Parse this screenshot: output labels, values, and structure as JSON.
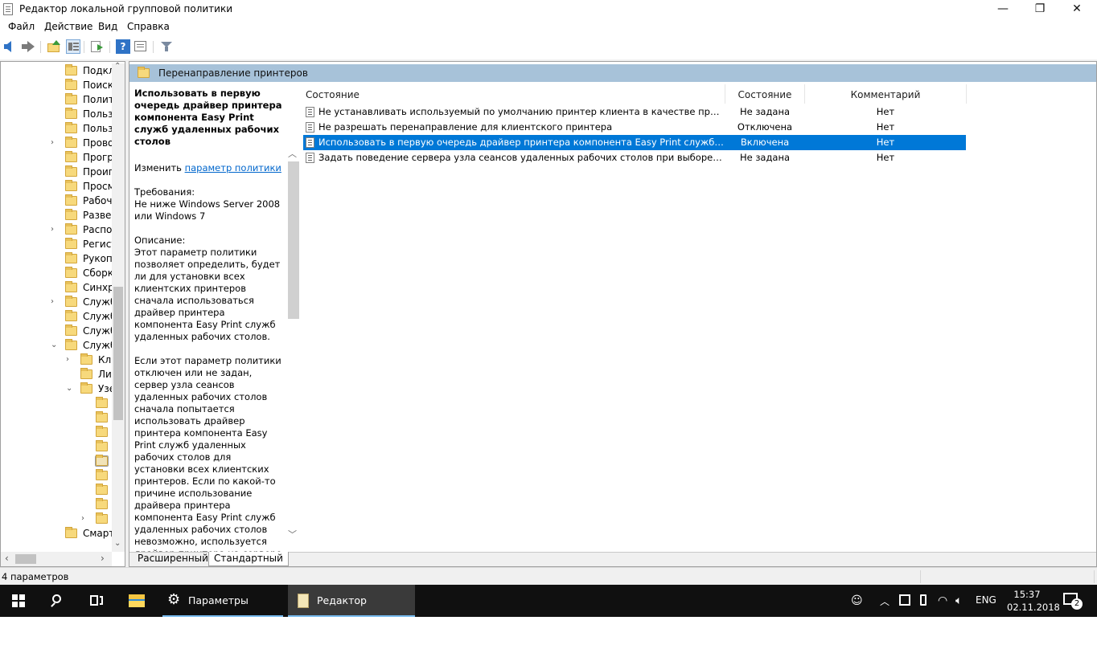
{
  "window": {
    "title": "Редактор локальной групповой политики",
    "controls": {
      "minimize": "—",
      "maximize": "❐",
      "close": "✕"
    }
  },
  "menu": [
    "Файл",
    "Действие",
    "Вид",
    "Справка"
  ],
  "tree": {
    "items": [
      {
        "label": "Подкл",
        "expander": ""
      },
      {
        "label": "Поиск",
        "expander": ""
      },
      {
        "label": "Полит",
        "expander": ""
      },
      {
        "label": "Польз",
        "expander": ""
      },
      {
        "label": "Польз",
        "expander": ""
      },
      {
        "label": "Прово",
        "expander": "›"
      },
      {
        "label": "Прогр",
        "expander": ""
      },
      {
        "label": "Проиг",
        "expander": ""
      },
      {
        "label": "Просм",
        "expander": ""
      },
      {
        "label": "Рабоч",
        "expander": ""
      },
      {
        "label": "Развер",
        "expander": ""
      },
      {
        "label": "Распол",
        "expander": "›"
      },
      {
        "label": "Регист",
        "expander": ""
      },
      {
        "label": "Рукопі",
        "expander": ""
      },
      {
        "label": "Сборк",
        "expander": ""
      },
      {
        "label": "Синхр",
        "expander": ""
      },
      {
        "label": "Служб",
        "expander": "›"
      },
      {
        "label": "Служб",
        "expander": ""
      },
      {
        "label": "Служб",
        "expander": ""
      },
      {
        "label": "Служб",
        "expander": "⌄"
      },
      {
        "label": "Кли",
        "expander": "›"
      },
      {
        "label": "Ли",
        "expander": ""
      },
      {
        "label": "Узе",
        "expander": "⌄"
      },
      {
        "label": "",
        "expander": ""
      },
      {
        "label": "",
        "expander": ""
      },
      {
        "label": "",
        "expander": ""
      },
      {
        "label": "",
        "expander": ""
      },
      {
        "label": "",
        "expander": ""
      },
      {
        "label": "",
        "expander": ""
      },
      {
        "label": "",
        "expander": ""
      },
      {
        "label": "",
        "expander": ""
      },
      {
        "label": "",
        "expander": "›"
      },
      {
        "label": "Смарт",
        "expander": ""
      }
    ]
  },
  "content": {
    "header_title": "Перенаправление принтеров",
    "description": {
      "title": "Использовать в первую очередь драйвер принтера компонента Easy Print служб удаленных рабочих столов",
      "edit_prefix": "Изменить ",
      "edit_link": "параметр политики",
      "requirements_label": "Требования:",
      "requirements_text": "Не ниже Windows Server 2008 или Windows 7",
      "description_label": "Описание:",
      "description_text": "Этот параметр политики позволяет определить, будет ли для установки всех клиентских принтеров сначала использоваться драйвер принтера компонента Easy Print служб удаленных рабочих столов.",
      "description_text2": "Если этот параметр политики отключен или не задан, сервер узла сеансов удаленных рабочих столов сначала попытается использовать драйвер принтера компонента Easy Print служб удаленных рабочих столов для установки всех клиентских принтеров. Если по какой-то причине использование драйвера принтера компонента Easy Print служб удаленных рабочих столов невозможно, используется драйвер принтера на сервере узла сеансов удаленных рабочих столов, соответствующий клиентскому"
    },
    "columns": [
      "Состояние",
      "Состояние",
      "Комментарий"
    ],
    "rows": [
      {
        "name": "Не устанавливать используемый по умолчанию принтер клиента в качестве принтера д...",
        "state": "Не задана",
        "comment": "Нет",
        "selected": false
      },
      {
        "name": "Не разрешать перенаправление для клиентского принтера",
        "state": "Отключена",
        "comment": "Нет",
        "selected": false
      },
      {
        "name": "Использовать в первую очередь драйвер принтера компонента Easy Print служб удаленн...",
        "state": "Включена",
        "comment": "Нет",
        "selected": true
      },
      {
        "name": "Задать поведение сервера узла сеансов удаленных рабочих столов при выборе резервно...",
        "state": "Не задана",
        "comment": "Нет",
        "selected": false
      }
    ],
    "tabs": [
      "Расширенный",
      "Стандартный"
    ]
  },
  "status": {
    "text": "4 параметров"
  },
  "taskbar": {
    "apps": [
      {
        "label": "Параметры"
      },
      {
        "label": "Редактор локальн..."
      }
    ],
    "language": "ENG",
    "time": "15:37",
    "date": "02.11.2018",
    "notifications": "2"
  },
  "colors": {
    "selection": "#0078d7",
    "header_band": "#a7c2d9",
    "taskbar": "#101010",
    "link": "#0066cc"
  }
}
